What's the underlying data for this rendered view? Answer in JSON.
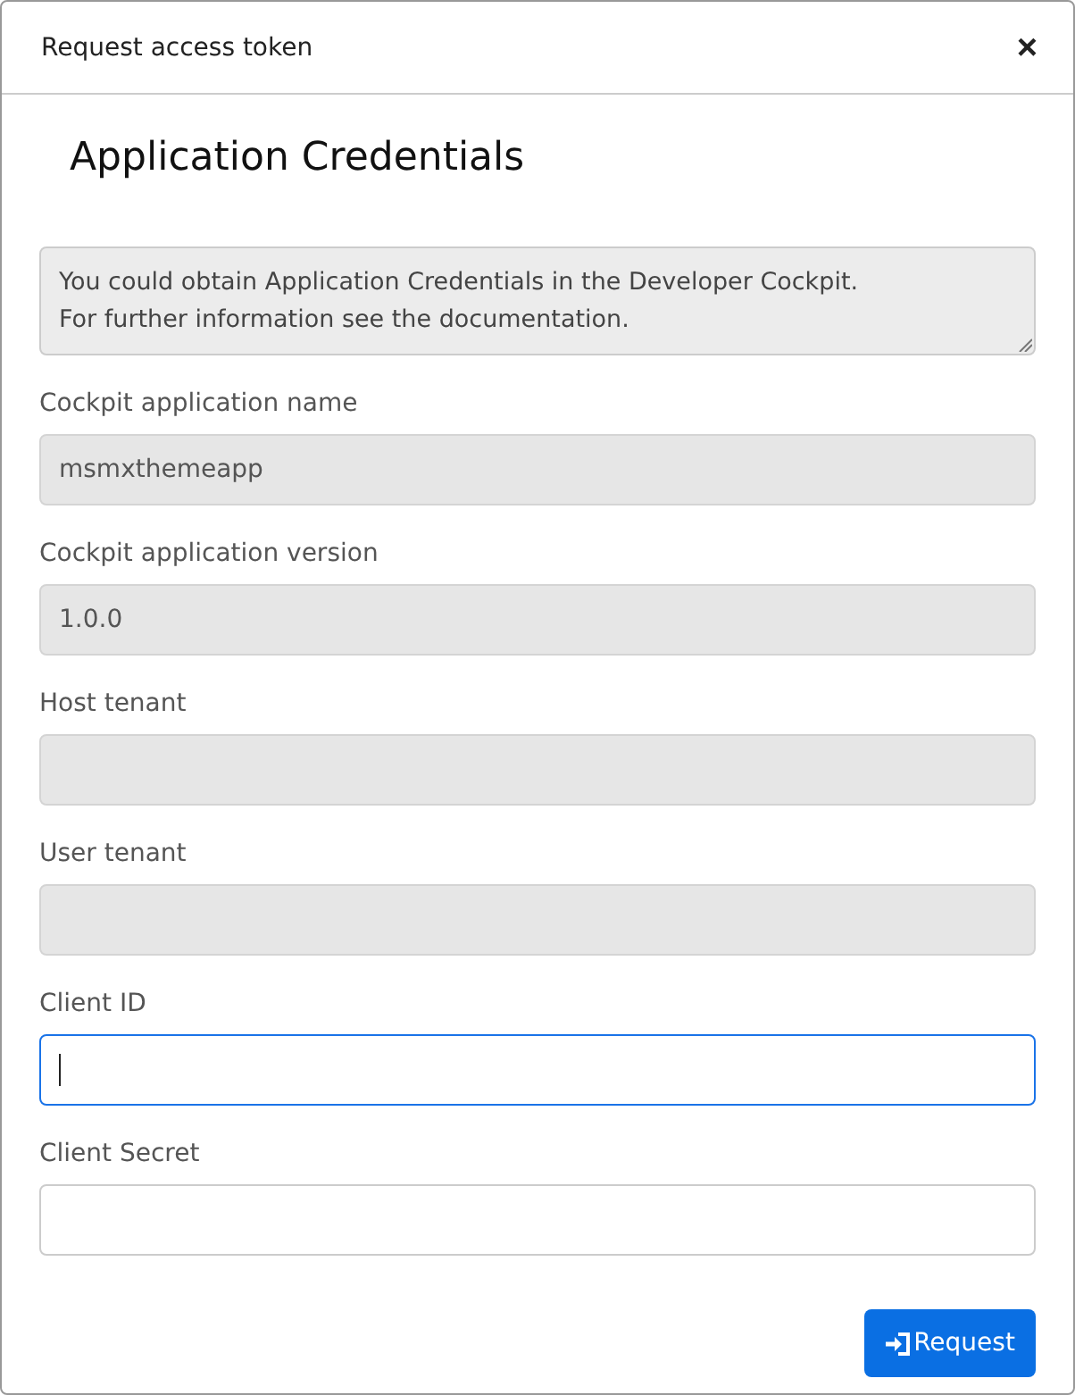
{
  "dialog": {
    "title": "Request access token",
    "close": "×"
  },
  "heading": "Application Credentials",
  "info": {
    "lines": [
      "You could obtain Application Credentials in the Developer Cockpit.",
      "For further information see the documentation."
    ]
  },
  "fields": [
    {
      "label": "Cockpit application name",
      "value": "msmxthemeapp",
      "disabled": true,
      "focused": false
    },
    {
      "label": "Cockpit application version",
      "value": "1.0.0",
      "disabled": true,
      "focused": false
    },
    {
      "label": "Host tenant",
      "disabled": true,
      "focused": false
    },
    {
      "label": "User tenant",
      "disabled": true,
      "focused": false
    },
    {
      "label": "Client ID",
      "disabled": false,
      "focused": true
    },
    {
      "label": "Client Secret",
      "disabled": false,
      "focused": false
    }
  ],
  "buttons": [
    {
      "label": "Request"
    }
  ]
}
